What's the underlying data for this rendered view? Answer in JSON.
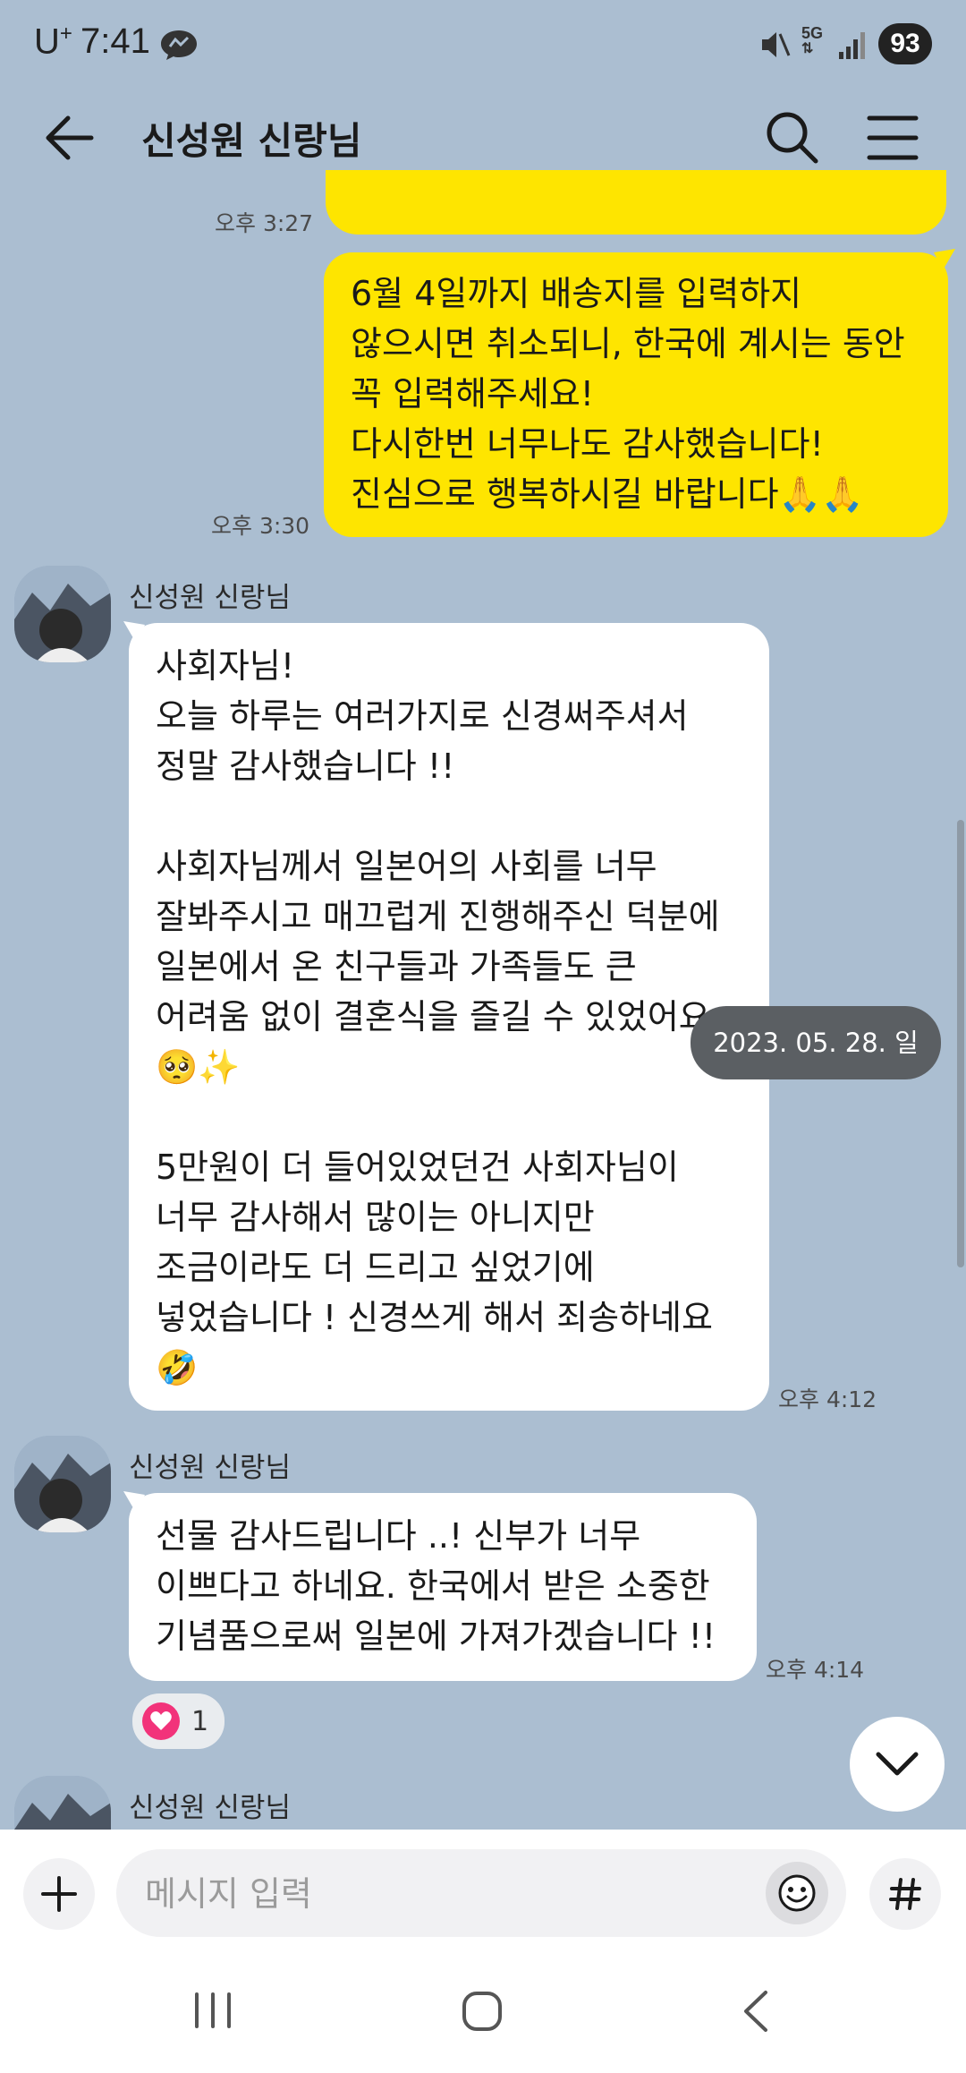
{
  "status_bar": {
    "carrier": "U",
    "carrier_sup": "+",
    "time": "7:41",
    "network": "5G",
    "battery": "93"
  },
  "header": {
    "back_icon": "arrow-left-icon",
    "title": "신성원 신랑님",
    "search_icon": "search-icon",
    "menu_icon": "hamburger-menu-icon"
  },
  "messages": {
    "prev_time": "오후 3:27",
    "m1": {
      "text": "6월 4일까지 배송지를 입력하지\n않으시면 취소되니, 한국에 계시는 동안\n꼭 입력해주세요!\n다시한번 너무나도 감사했습니다!\n진심으로 행복하시길 바랍니다🙏🙏",
      "time": "오후 3:30"
    },
    "m2": {
      "sender": "신성원 신랑님",
      "text": "사회자님!\n오늘 하루는 여러가지로 신경써주셔서\n정말 감사했습니다 !!\n\n사회자님께서 일본어의 사회를 너무\n잘봐주시고 매끄럽게 진행해주신 덕분에\n일본에서 온 친구들과 가족들도 큰\n어려움 없이 결혼식을 즐길 수 있었어요\n🥺✨\n\n5만원이 더 들어있었던건 사회자님이\n너무 감사해서 많이는 아니지만\n조금이라도 더 드리고 싶었기에\n넣었습니다 ! 신경쓰게 해서 죄송하네요\n🤣",
      "time": "오후 4:12"
    },
    "m3": {
      "sender": "신성원 신랑님",
      "text": "선물 감사드립니다 ..! 신부가 너무\n이쁘다고 하네요. 한국에서 받은 소중한\n기념품으로써 일본에 가져가겠습니다 !!",
      "time": "오후 4:14",
      "reaction_count": "1"
    },
    "m4": {
      "sender": "신성원 신랑님"
    },
    "date_divider": "2023. 05. 28. 일"
  },
  "input": {
    "placeholder": "메시지 입력"
  },
  "colors": {
    "background": "#abbed1",
    "my_bubble": "#fee500",
    "their_bubble": "#ffffff"
  }
}
